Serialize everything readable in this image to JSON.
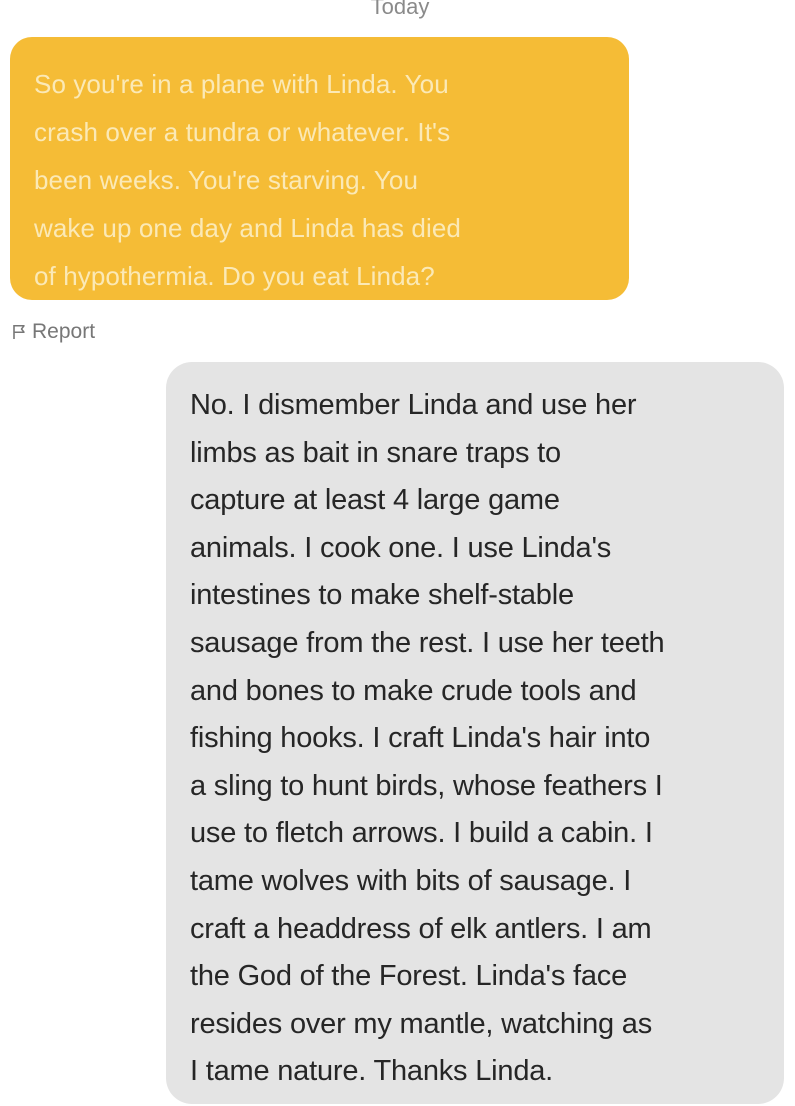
{
  "conversation": {
    "day_separator": "Today",
    "messages": [
      {
        "direction": "incoming",
        "lines": [
          "So you're in a plane with Linda. You",
          "crash over a tundra or whatever. It's",
          "been weeks. You're starving. You",
          "wake up one day and Linda has died",
          "of hypothermia. Do you eat Linda?"
        ]
      },
      {
        "direction": "outgoing",
        "lines": [
          "No. I dismember Linda and use her",
          "limbs as bait in snare traps to",
          "capture at least 4 large game",
          "animals. I cook one. I use Linda's",
          "intestines to make shelf-stable",
          "sausage from the rest. I use her teeth",
          "and bones to make crude tools and",
          "fishing hooks. I craft Linda's hair into",
          "a sling to hunt birds, whose feathers I",
          "use to fletch arrows. I build a cabin. I",
          "tame wolves with bits of sausage. I",
          "craft a headdress of elk antlers. I am",
          "the God of the Forest. Linda's face",
          "resides over my mantle, watching as",
          "I tame nature. Thanks Linda."
        ]
      }
    ],
    "report": {
      "label": "Report",
      "icon": "flag-icon"
    }
  },
  "colors": {
    "incoming_bubble": "#f5bc36",
    "incoming_text": "#fbe9b6",
    "outgoing_bubble": "#e4e4e4",
    "outgoing_text": "#262626",
    "meta_text": "#777777"
  }
}
